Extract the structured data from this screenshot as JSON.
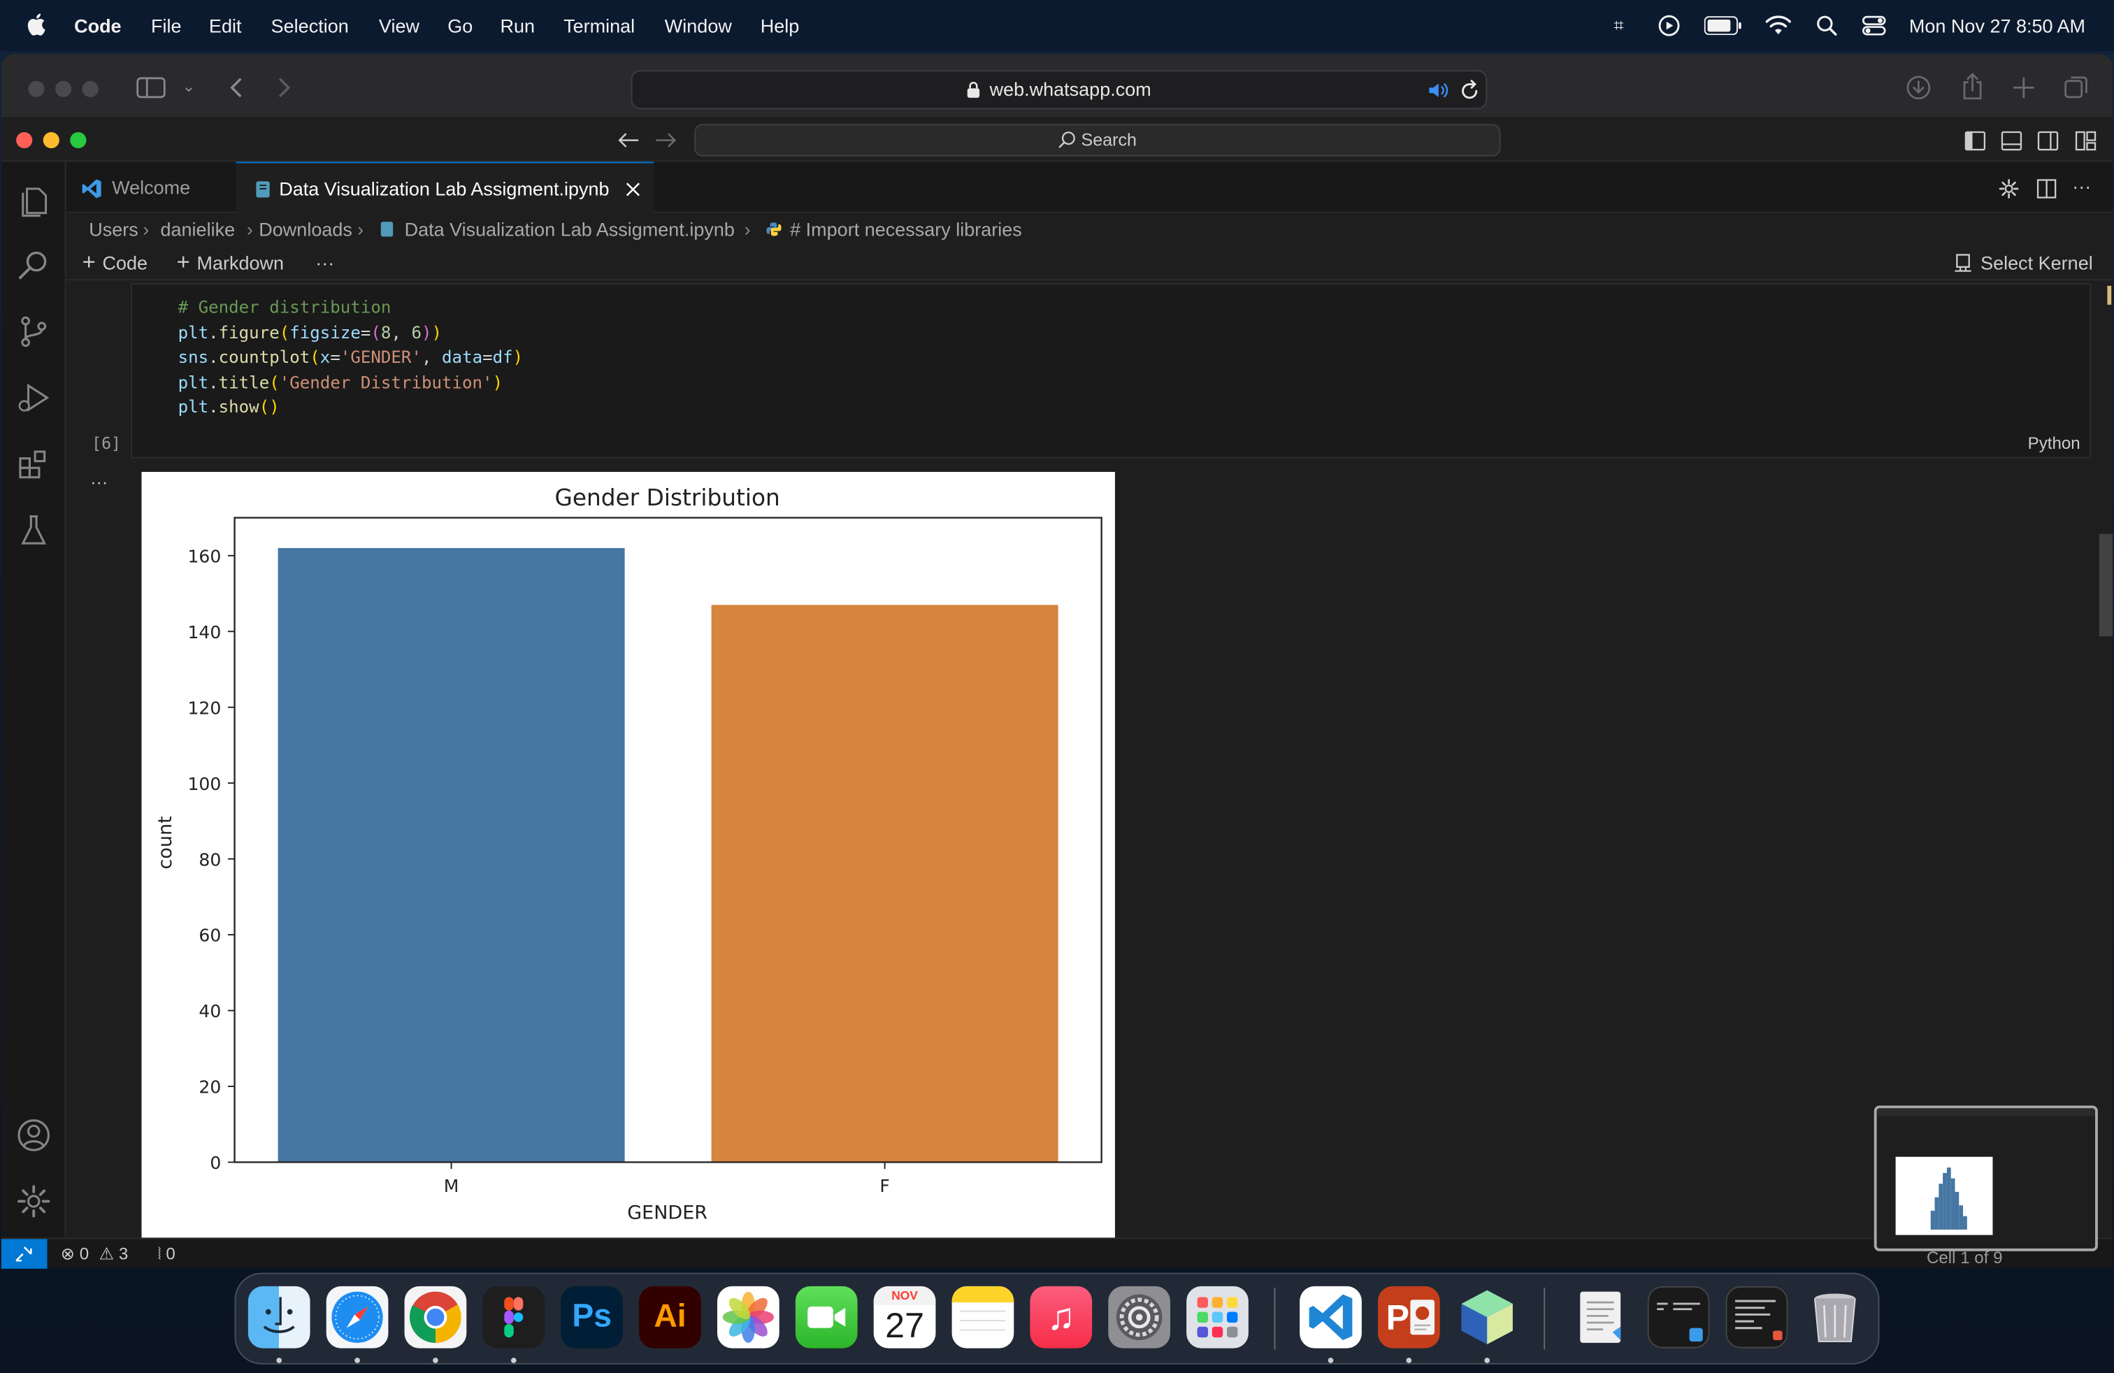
{
  "menubar": {
    "app_name": "Code",
    "items": [
      "File",
      "Edit",
      "Selection",
      "View",
      "Go",
      "Run",
      "Terminal",
      "Window",
      "Help"
    ],
    "clock": "Mon Nov 27  8:50 AM"
  },
  "safari": {
    "url": "web.whatsapp.com"
  },
  "vscode": {
    "search_label": "Search",
    "tabs": [
      {
        "label": "Welcome"
      },
      {
        "label": "Data Visualization Lab Assigment.ipynb"
      }
    ],
    "breadcrumb": [
      "Users",
      "danielike",
      "Downloads",
      "Data Visualization Lab Assigment.ipynb",
      "# Import necessary libraries"
    ],
    "toolbar": {
      "code_label": "Code",
      "markdown_label": "Markdown",
      "more_label": "···",
      "kernel_label": "Select Kernel"
    },
    "cell": {
      "exec_count": "[6]",
      "language": "Python",
      "output_more": "···",
      "code_lines": [
        "# Gender distribution",
        "plt.figure(figsize=(8, 6))",
        "sns.countplot(x='GENDER', data=df)",
        "plt.title('Gender Distribution')",
        "plt.show()"
      ]
    },
    "statusbar": {
      "errors": "0",
      "warnings": "3",
      "ports": "0",
      "cell_position": "Cell 1 of 9"
    }
  },
  "chart_data": {
    "type": "bar",
    "title": "Gender Distribution",
    "xlabel": "GENDER",
    "ylabel": "count",
    "categories": [
      "M",
      "F"
    ],
    "values": [
      162,
      147
    ],
    "colors": [
      "#4676a2",
      "#d6843e"
    ],
    "ylim": [
      0,
      170
    ],
    "yticks": [
      0,
      20,
      40,
      60,
      80,
      100,
      120,
      140,
      160
    ],
    "grid": false
  },
  "dock": {
    "apps": [
      {
        "name": "finder",
        "label": ""
      },
      {
        "name": "safari",
        "label": ""
      },
      {
        "name": "chrome",
        "label": ""
      },
      {
        "name": "figma",
        "label": ""
      },
      {
        "name": "photoshop",
        "label": "Ps"
      },
      {
        "name": "illustrator",
        "label": "Ai"
      },
      {
        "name": "photos",
        "label": ""
      },
      {
        "name": "facetime",
        "label": ""
      },
      {
        "name": "calendar",
        "label": "27",
        "month": "NOV"
      },
      {
        "name": "notes",
        "label": ""
      },
      {
        "name": "music",
        "label": "♫"
      },
      {
        "name": "system-settings",
        "label": ""
      },
      {
        "name": "launchpad",
        "label": ""
      },
      {
        "name": "vscode",
        "label": ""
      },
      {
        "name": "powerpoint",
        "label": "P"
      },
      {
        "name": "blockbench",
        "label": ""
      }
    ]
  }
}
